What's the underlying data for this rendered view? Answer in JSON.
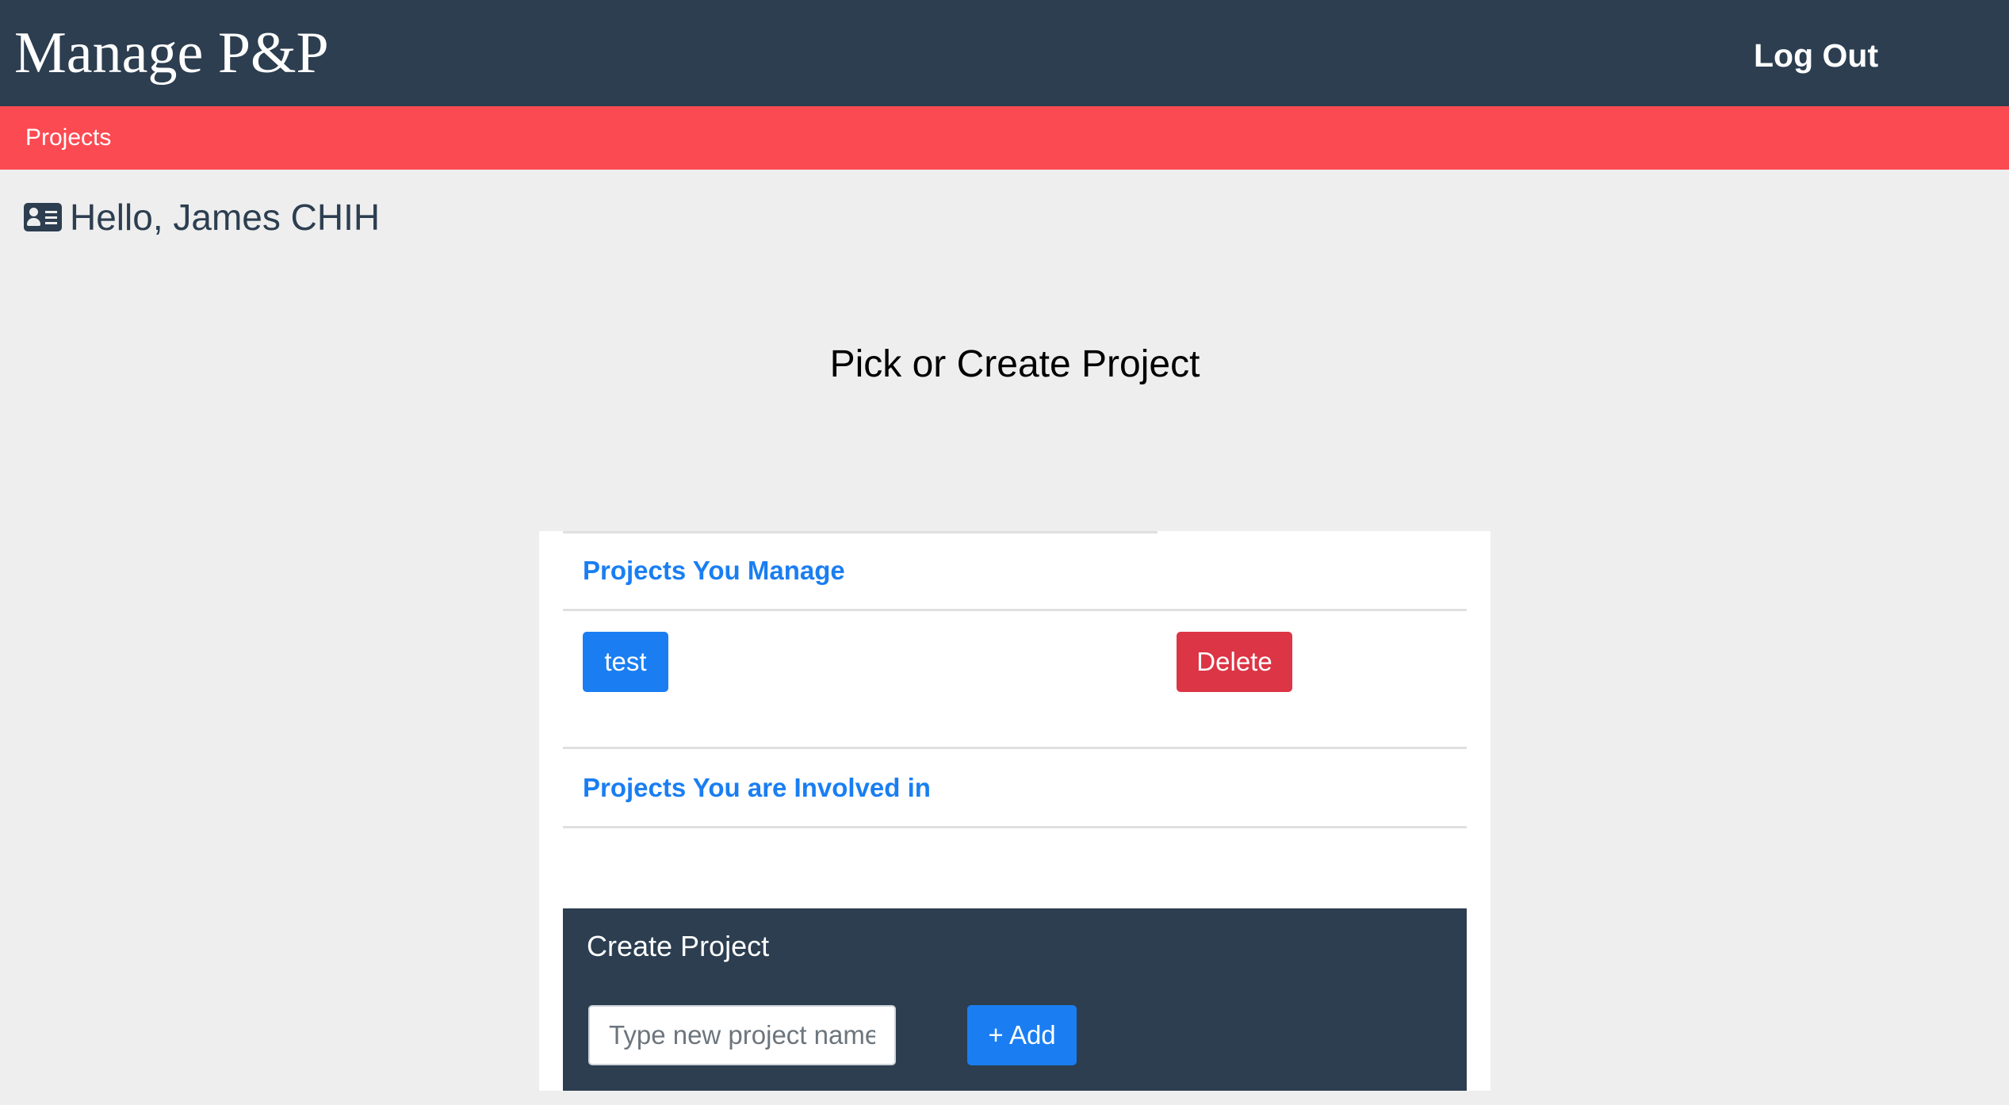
{
  "header": {
    "brand": "Manage P&P",
    "logout_label": "Log Out"
  },
  "nav": {
    "items": [
      {
        "label": "Projects"
      }
    ]
  },
  "greeting": {
    "icon": "id-card-icon",
    "text": "Hello, James CHIH"
  },
  "page_title": "Pick or Create Project",
  "managed_section": {
    "heading": "Projects You Manage",
    "projects": [
      {
        "name": "test",
        "delete_label": "Delete"
      }
    ]
  },
  "involved_section": {
    "heading": "Projects You are Involved in",
    "projects": []
  },
  "create_project": {
    "title": "Create Project",
    "input_value": "",
    "input_placeholder": "Type new project name",
    "add_label": "+ Add"
  },
  "colors": {
    "header_bg": "#2c3e50",
    "nav_bg": "#fc4a52",
    "primary": "#1a7ef2",
    "danger": "#dc3545",
    "page_bg": "#eeeeee"
  }
}
